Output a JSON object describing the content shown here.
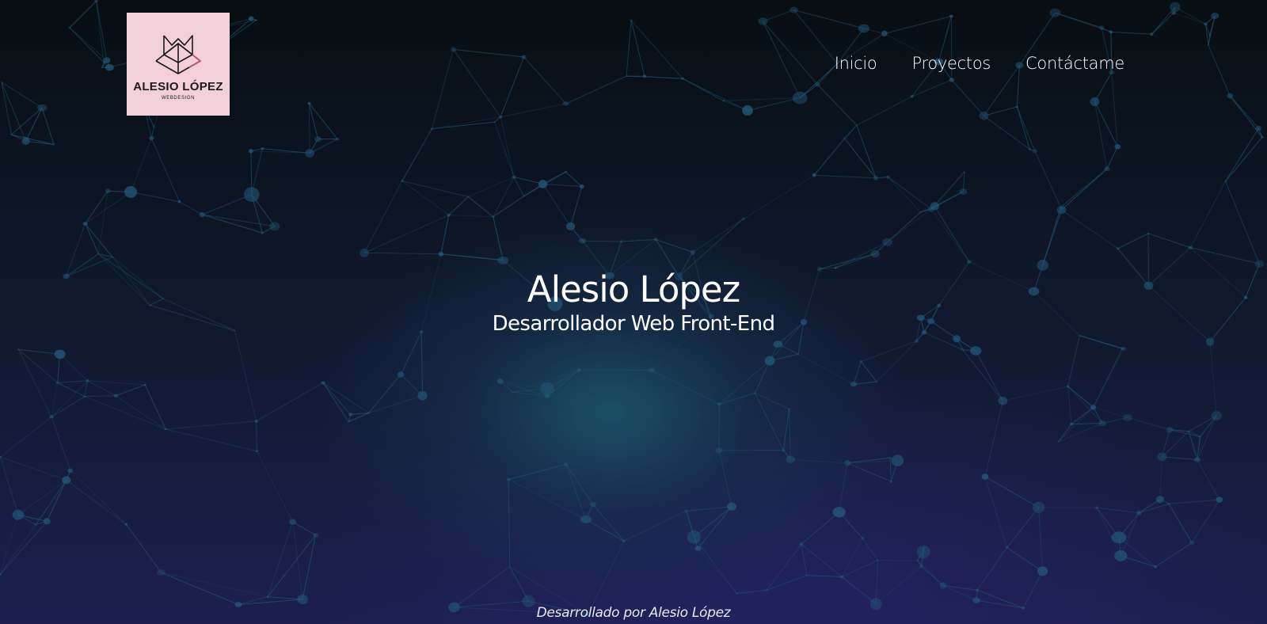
{
  "header": {
    "logo": {
      "title": "ALESIO LÓPEZ",
      "subtitle": "WEBDESIGN",
      "icon": "geometric-fox-icon",
      "background_color": "#f3cfd9"
    },
    "nav": [
      {
        "label": "Inicio"
      },
      {
        "label": "Proyectos"
      },
      {
        "label": "Contáctame"
      }
    ]
  },
  "hero": {
    "title": "Alesio López",
    "subtitle": "Desarrollador Web Front-End"
  },
  "footer": {
    "credit": "Desarrollado por Alesio López"
  },
  "colors": {
    "background_top": "#070d10",
    "background_bottom": "#1d1e4f",
    "network_lines": "#1f4e6b",
    "network_nodes": "#23587a",
    "text": "#ffffff"
  }
}
